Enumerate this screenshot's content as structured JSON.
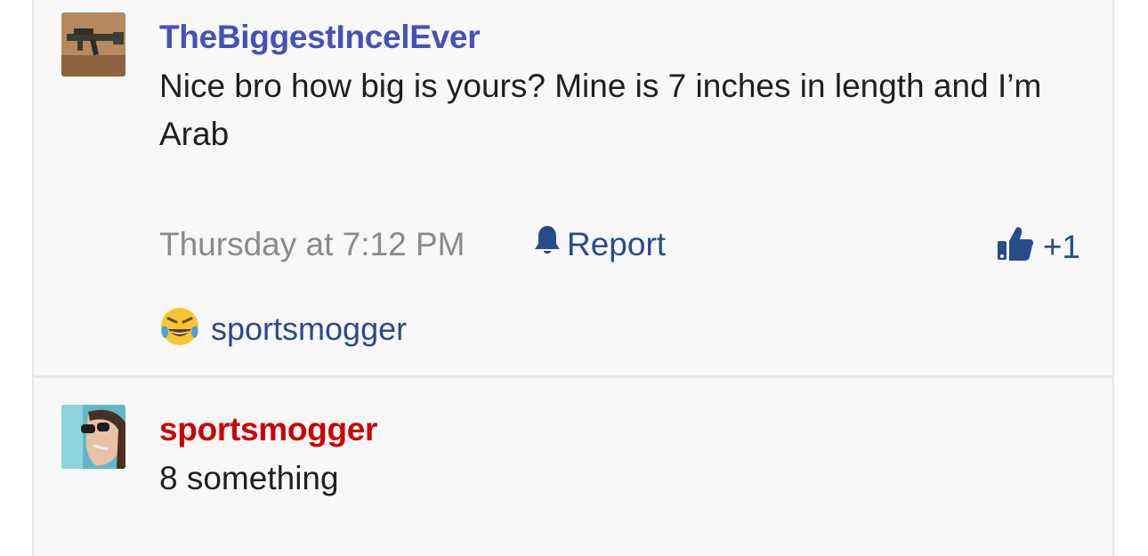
{
  "posts": [
    {
      "username": "TheBiggestIncelEver",
      "message": "Nice bro how big is yours? Mine is 7 inches in length and I’m Arab",
      "timestamp": "Thursday at 7:12 PM",
      "report_label": "Report",
      "like_count": "+1",
      "reactions": {
        "user": "sportsmogger",
        "icon": "laughing-crying-emoji-icon"
      }
    },
    {
      "username": "sportsmogger",
      "message": "8 something"
    }
  ],
  "colors": {
    "username_default": "#4452b8",
    "username_highlight": "#cc0000",
    "link": "#2a4a8a",
    "timestamp": "#8a8a8a",
    "background": "#f8f8f8"
  },
  "icons": [
    "bell-icon",
    "thumbs-up-icon",
    "laughing-crying-emoji-icon"
  ]
}
